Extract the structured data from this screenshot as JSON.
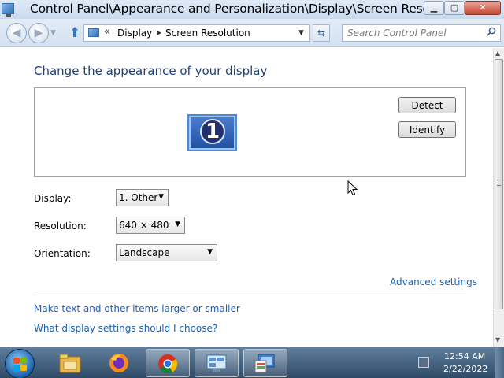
{
  "window": {
    "title": "Control Panel\\Appearance and Personalization\\Display\\Screen Resolution"
  },
  "address_bar": {
    "chevron": "«",
    "crumbs": [
      "Display",
      "Screen Resolution"
    ]
  },
  "search": {
    "placeholder": "Search Control Panel"
  },
  "main": {
    "title": "Change the appearance of your display",
    "monitor_number": "1",
    "detect_label": "Detect",
    "identify_label": "Identify",
    "display_label": "Display:",
    "display_value": "1. Other",
    "resolution_label": "Resolution:",
    "resolution_value": "640 × 480",
    "orientation_label": "Orientation:",
    "orientation_value": "Landscape",
    "advanced_link": "Advanced settings",
    "links": [
      "Make text and other items larger or smaller",
      "What display settings should I choose?"
    ]
  },
  "taskbar": {
    "time": "12:54 AM",
    "date": "2/22/2022"
  },
  "colors": {
    "title_text": "#1e3e78",
    "link": "#1e5fb3",
    "close_button": "#c7452e",
    "taskbar": "#2f4a66"
  },
  "icons": {
    "app": "display-control-panel-icon",
    "back": "back-arrow-icon",
    "forward": "forward-arrow-icon",
    "up": "up-arrow-icon",
    "refresh": "refresh-icon",
    "search": "search-icon"
  }
}
